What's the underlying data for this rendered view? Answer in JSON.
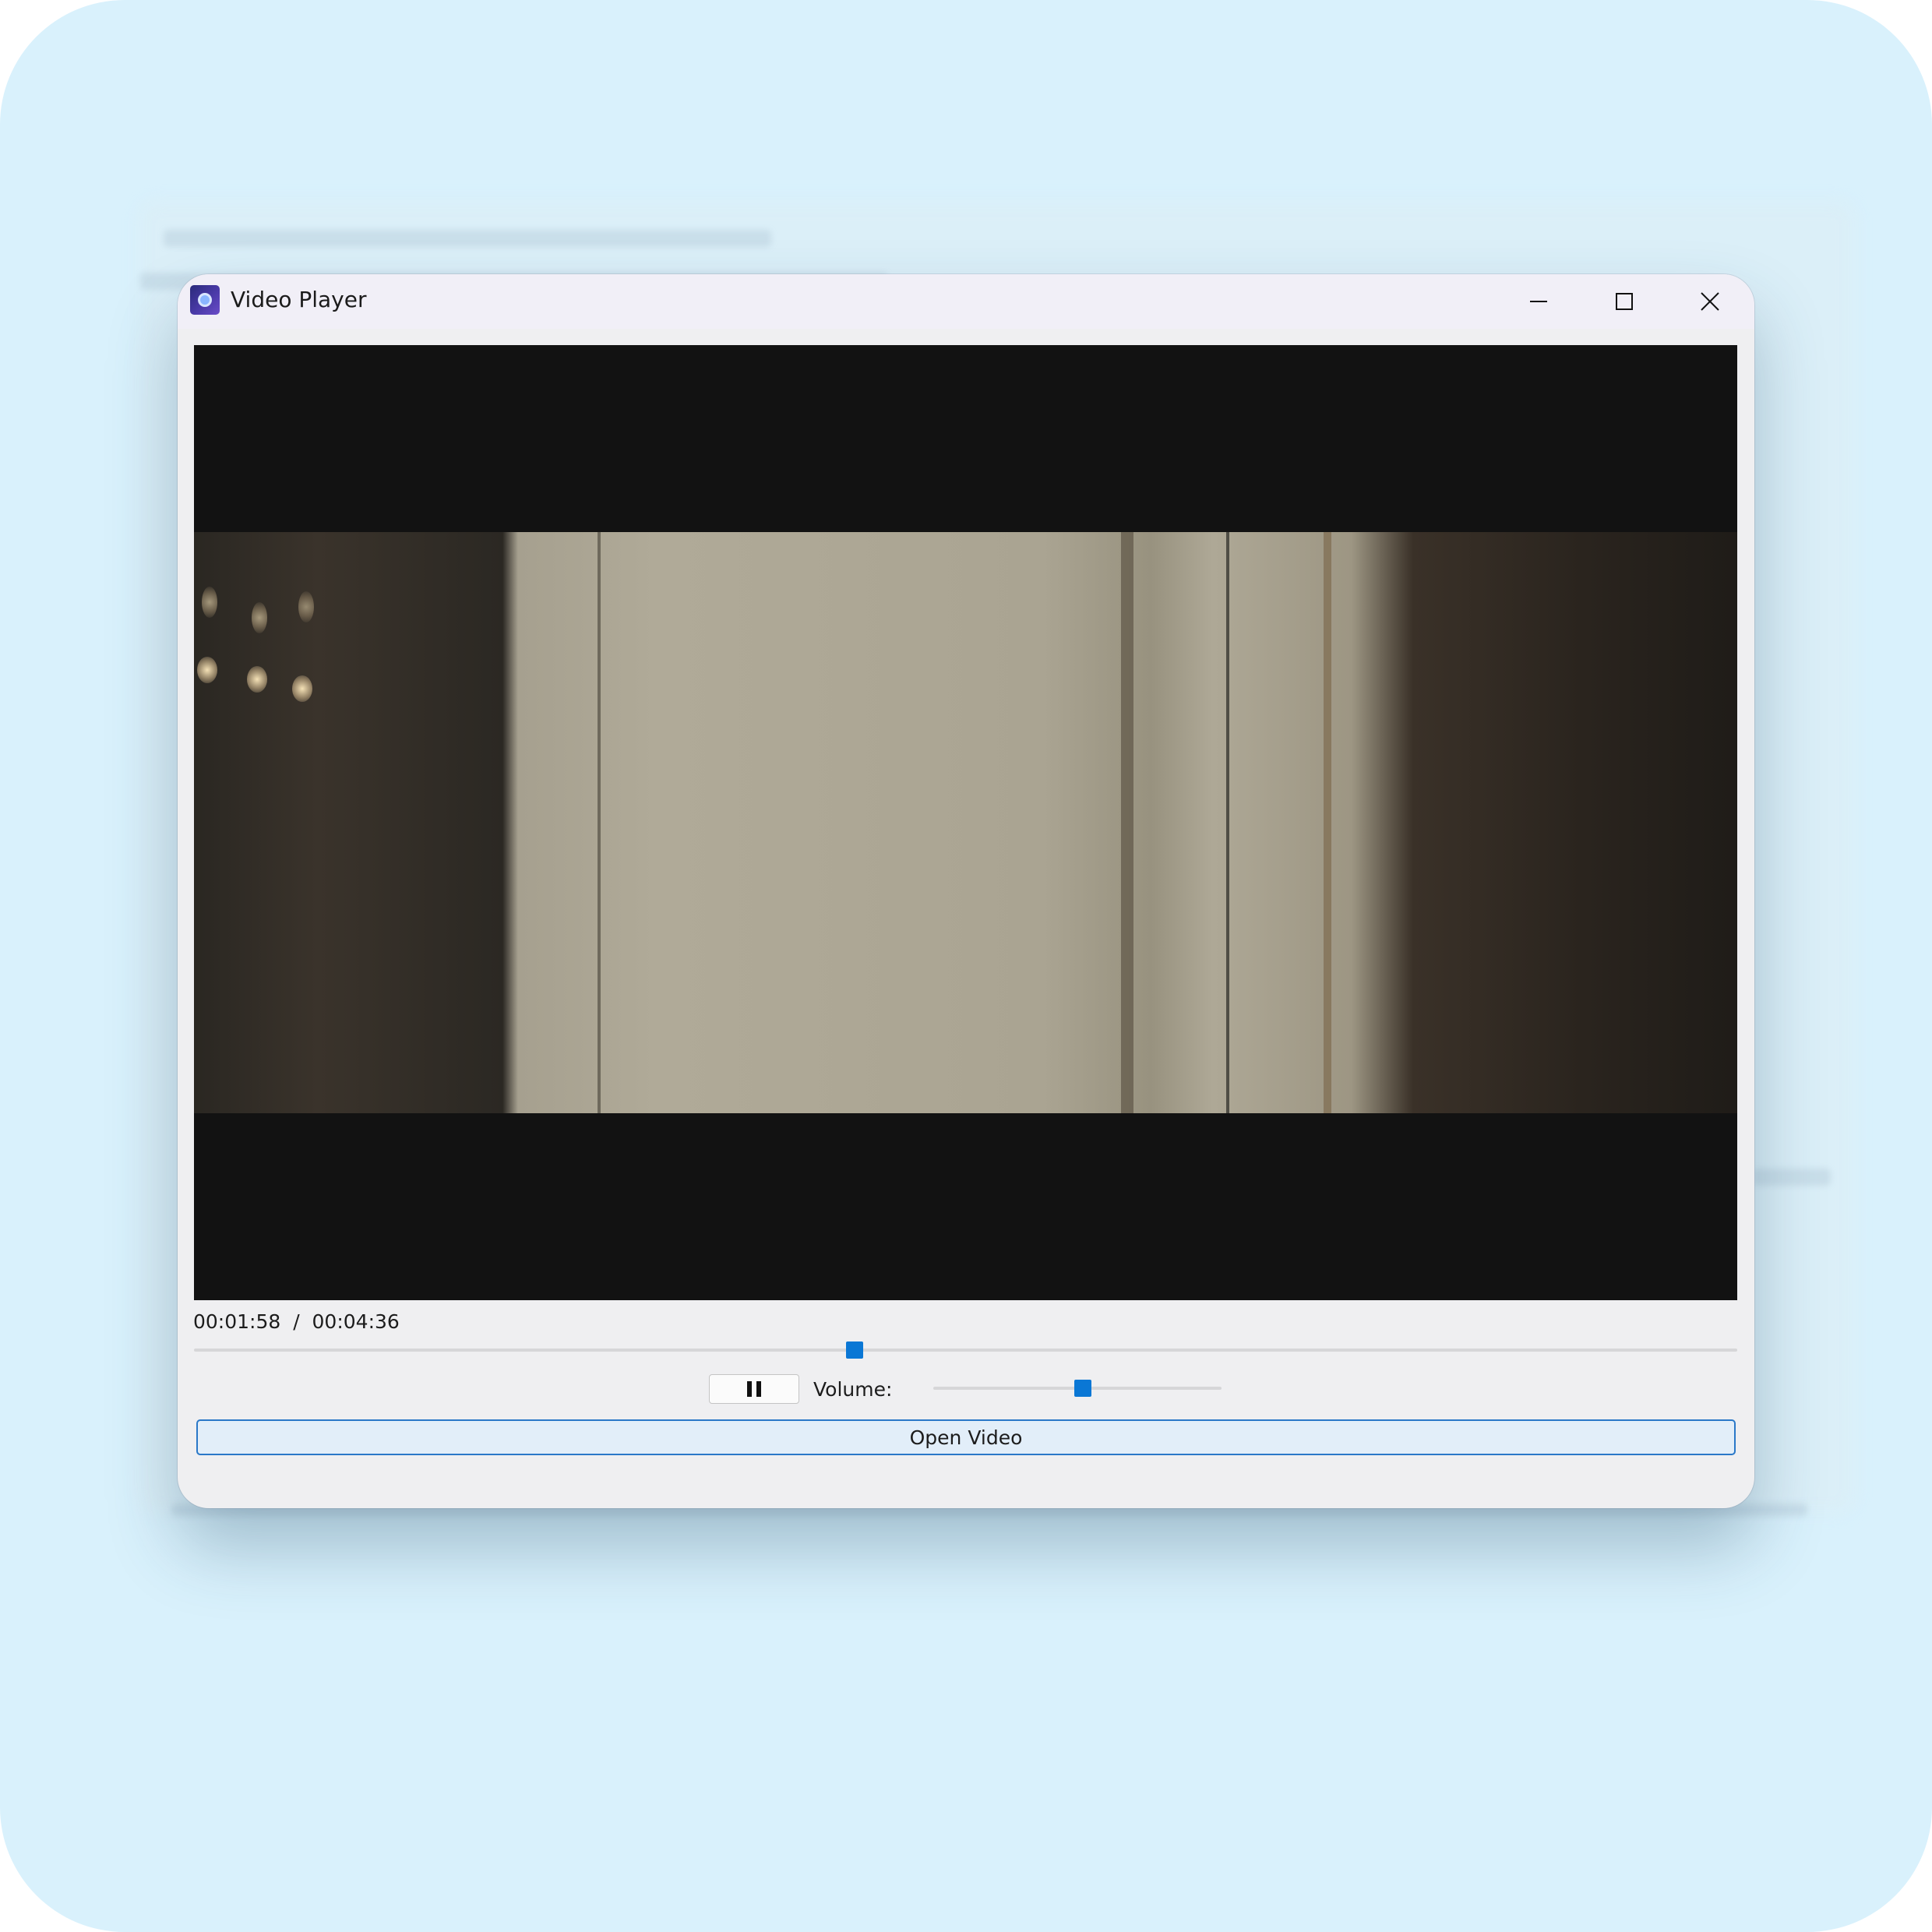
{
  "window": {
    "title": "Video Player",
    "app_icon": "video-player-app-icon",
    "controls": {
      "minimize_icon": "minimize-icon",
      "maximize_icon": "maximize-icon",
      "close_icon": "close-icon"
    }
  },
  "player": {
    "current_time": "00:01:58",
    "separator": "/",
    "total_time": "00:04:36",
    "progress_fraction": 0.428,
    "pause_icon": "pause-icon",
    "volume_label": "Volume:",
    "volume_fraction": 0.52,
    "open_button_label": "Open Video"
  },
  "colors": {
    "accent": "#0a77d5",
    "button_border": "#2a78c8",
    "video_background": "#121212",
    "page_background": "#d9f1fc"
  }
}
